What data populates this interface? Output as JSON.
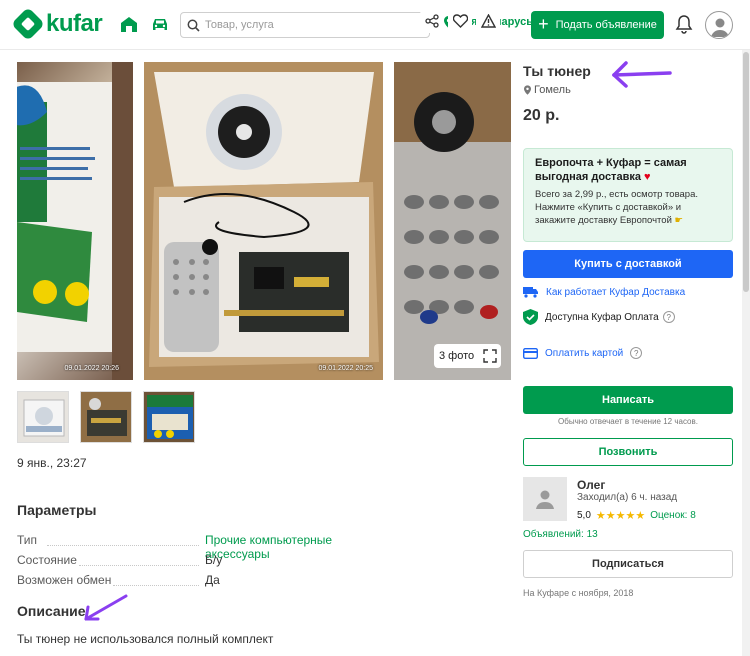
{
  "header": {
    "logo_text": "kufar",
    "search_placeholder": "Товар, услуга",
    "region": "Вся Беларусь",
    "post_button": "Подать объявление"
  },
  "gallery": {
    "timestamps": [
      "09.01.2022 20:26",
      "09.01.2022 20:25"
    ],
    "photo_count": "3 фото"
  },
  "posted_date": "9 янв., 23:27",
  "params": {
    "heading": "Параметры",
    "rows": [
      {
        "label": "Тип",
        "value": "Прочие компьютерные аксессуары"
      },
      {
        "label": "Состояние",
        "value": "Б/у"
      },
      {
        "label": "Возможен обмен",
        "value": "Да"
      }
    ]
  },
  "description": {
    "heading": "Описание",
    "text": "Ты тюнер не использовался полный комплект"
  },
  "listing": {
    "title": "Ты тюнер",
    "location": "Гомель",
    "price": "20 р."
  },
  "promo": {
    "title": "Европочта + Куфар = самая выгодная доставка",
    "text": "Всего за 2,99 р., есть осмотр товара. Нажмите «Купить с доставкой» и закажите доставку Европочтой"
  },
  "actions": {
    "buy_delivery": "Купить с доставкой",
    "how_delivery": "Как работает Куфар Доставка",
    "payment_available": "Доступна Куфар Оплата",
    "pay_by_card": "Оплатить картой",
    "write": "Написать",
    "reply_note": "Обычно отвечает в течение 12 часов.",
    "call": "Позвонить",
    "subscribe": "Подписаться"
  },
  "seller": {
    "name": "Олег",
    "last_seen": "Заходил(а) 6 ч. назад",
    "rating": "5,0",
    "reviews": "Оценок: 8",
    "ads": "Объявлений: 13",
    "since": "На Куфаре с ноября, 2018"
  },
  "colors": {
    "brand_green": "#009b4e",
    "action_blue": "#1e66f5",
    "annotation_purple": "#8a3ff0"
  }
}
